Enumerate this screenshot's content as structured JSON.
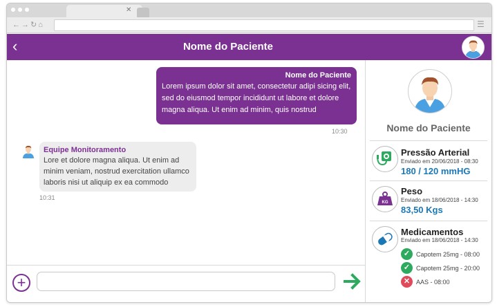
{
  "header": {
    "title": "Nome do Paciente"
  },
  "messages": {
    "outgoing": {
      "sender": "Nome do Paciente",
      "text": "Lorem ipsum dolor sit amet, consectetur adipi sicing elit, sed do eiusmod tempor incididunt ut labore et dolore magna aliqua. Ut enim ad minim, quis nostrud",
      "time": "10:30"
    },
    "incoming": {
      "sender": "Equipe Monitoramento",
      "text": "Lore et dolore magna aliqua. Ut enim ad minim veniam, nostrud exercitation ullamco laboris nisi ut aliquip ex ea commodo",
      "time": "10:31"
    }
  },
  "composer": {
    "value": "",
    "placeholder": ""
  },
  "patient": {
    "name": "Nome do Paciente",
    "vitals": [
      {
        "title": "Pressão Arterial",
        "date": "Enviado em 20/06/2018 - 08:30",
        "value": "180 / 120 mmHG",
        "icon": "blood-pressure-icon"
      },
      {
        "title": "Peso",
        "date": "Enviado em 18/06/2018 - 14:30",
        "value": "83,50 Kgs",
        "icon": "weight-icon"
      }
    ],
    "medications": {
      "title": "Medicamentos",
      "date": "Enviado em 18/06/2018 - 14:30",
      "icon": "pill-icon",
      "items": [
        {
          "label": "Capotem 25mg - 08:00",
          "status": "taken",
          "color": "#2eaa5e"
        },
        {
          "label": "Capotem 25mg - 20:00",
          "status": "taken",
          "color": "#2eaa5e"
        },
        {
          "label": "AAS - 08:00",
          "status": "missed",
          "color": "#e04a5a"
        }
      ]
    }
  },
  "colors": {
    "brand": "#7b3191",
    "accent_value": "#1c78b5",
    "send": "#2eaa5e"
  }
}
